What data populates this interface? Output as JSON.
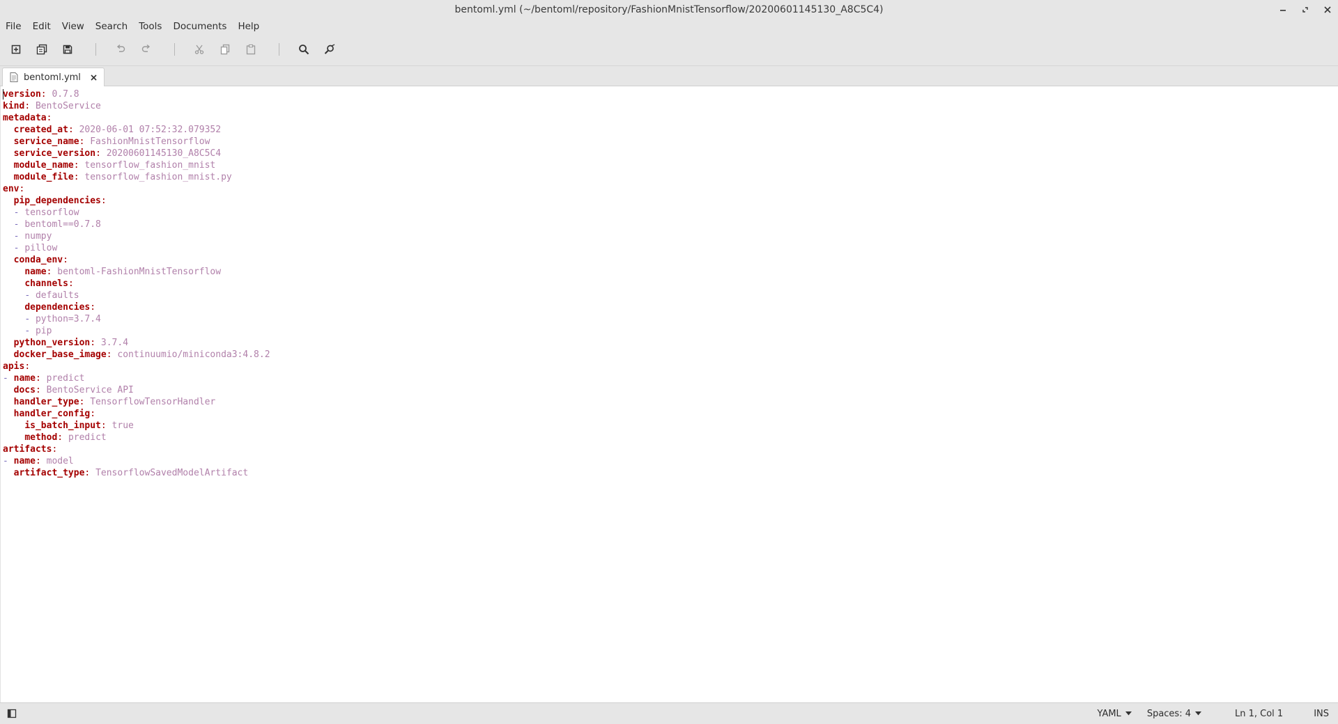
{
  "window": {
    "title": "bentoml.yml (~/bentoml/repository/FashionMnistTensorflow/20200601145130_A8C5C4)"
  },
  "menubar": {
    "items": [
      "File",
      "Edit",
      "View",
      "Search",
      "Tools",
      "Documents",
      "Help"
    ]
  },
  "toolbar": {
    "buttons": [
      {
        "name": "new-document-icon"
      },
      {
        "name": "open-document-icon"
      },
      {
        "name": "save-document-icon"
      },
      {
        "name": "undo-icon"
      },
      {
        "name": "redo-icon"
      },
      {
        "name": "cut-icon"
      },
      {
        "name": "copy-icon"
      },
      {
        "name": "paste-icon"
      },
      {
        "name": "search-icon"
      },
      {
        "name": "replace-icon"
      }
    ]
  },
  "tabs": [
    {
      "label": "bentoml.yml",
      "active": true
    }
  ],
  "editor": {
    "language": "yaml",
    "lines": [
      [
        {
          "t": "k",
          "s": "version"
        },
        {
          "t": "p",
          "s": ": "
        },
        {
          "t": "v",
          "s": "0.7.8"
        }
      ],
      [
        {
          "t": "k",
          "s": "kind"
        },
        {
          "t": "p",
          "s": ": "
        },
        {
          "t": "v",
          "s": "BentoService"
        }
      ],
      [
        {
          "t": "k",
          "s": "metadata"
        },
        {
          "t": "p",
          "s": ":"
        }
      ],
      [
        {
          "t": "x",
          "s": "  "
        },
        {
          "t": "k",
          "s": "created_at"
        },
        {
          "t": "p",
          "s": ": "
        },
        {
          "t": "v",
          "s": "2020-06-01 07:52:32.079352"
        }
      ],
      [
        {
          "t": "x",
          "s": "  "
        },
        {
          "t": "k",
          "s": "service_name"
        },
        {
          "t": "p",
          "s": ": "
        },
        {
          "t": "v",
          "s": "FashionMnistTensorflow"
        }
      ],
      [
        {
          "t": "x",
          "s": "  "
        },
        {
          "t": "k",
          "s": "service_version"
        },
        {
          "t": "p",
          "s": ": "
        },
        {
          "t": "v",
          "s": "20200601145130_A8C5C4"
        }
      ],
      [
        {
          "t": "x",
          "s": "  "
        },
        {
          "t": "k",
          "s": "module_name"
        },
        {
          "t": "p",
          "s": ": "
        },
        {
          "t": "v",
          "s": "tensorflow_fashion_mnist"
        }
      ],
      [
        {
          "t": "x",
          "s": "  "
        },
        {
          "t": "k",
          "s": "module_file"
        },
        {
          "t": "p",
          "s": ": "
        },
        {
          "t": "v",
          "s": "tensorflow_fashion_mnist.py"
        }
      ],
      [
        {
          "t": "k",
          "s": "env"
        },
        {
          "t": "p",
          "s": ":"
        }
      ],
      [
        {
          "t": "x",
          "s": "  "
        },
        {
          "t": "k",
          "s": "pip_dependencies"
        },
        {
          "t": "p",
          "s": ":"
        }
      ],
      [
        {
          "t": "x",
          "s": "  "
        },
        {
          "t": "d",
          "s": "- "
        },
        {
          "t": "v",
          "s": "tensorflow"
        }
      ],
      [
        {
          "t": "x",
          "s": "  "
        },
        {
          "t": "d",
          "s": "- "
        },
        {
          "t": "v",
          "s": "bentoml==0.7.8"
        }
      ],
      [
        {
          "t": "x",
          "s": "  "
        },
        {
          "t": "d",
          "s": "- "
        },
        {
          "t": "v",
          "s": "numpy"
        }
      ],
      [
        {
          "t": "x",
          "s": "  "
        },
        {
          "t": "d",
          "s": "- "
        },
        {
          "t": "v",
          "s": "pillow"
        }
      ],
      [
        {
          "t": "x",
          "s": "  "
        },
        {
          "t": "k",
          "s": "conda_env"
        },
        {
          "t": "p",
          "s": ":"
        }
      ],
      [
        {
          "t": "x",
          "s": "    "
        },
        {
          "t": "k",
          "s": "name"
        },
        {
          "t": "p",
          "s": ": "
        },
        {
          "t": "v",
          "s": "bentoml-FashionMnistTensorflow"
        }
      ],
      [
        {
          "t": "x",
          "s": "    "
        },
        {
          "t": "k",
          "s": "channels"
        },
        {
          "t": "p",
          "s": ":"
        }
      ],
      [
        {
          "t": "x",
          "s": "    "
        },
        {
          "t": "d",
          "s": "- "
        },
        {
          "t": "v",
          "s": "defaults"
        }
      ],
      [
        {
          "t": "x",
          "s": "    "
        },
        {
          "t": "k",
          "s": "dependencies"
        },
        {
          "t": "p",
          "s": ":"
        }
      ],
      [
        {
          "t": "x",
          "s": "    "
        },
        {
          "t": "d",
          "s": "- "
        },
        {
          "t": "v",
          "s": "python=3.7.4"
        }
      ],
      [
        {
          "t": "x",
          "s": "    "
        },
        {
          "t": "d",
          "s": "- "
        },
        {
          "t": "v",
          "s": "pip"
        }
      ],
      [
        {
          "t": "x",
          "s": "  "
        },
        {
          "t": "k",
          "s": "python_version"
        },
        {
          "t": "p",
          "s": ": "
        },
        {
          "t": "v",
          "s": "3.7.4"
        }
      ],
      [
        {
          "t": "x",
          "s": "  "
        },
        {
          "t": "k",
          "s": "docker_base_image"
        },
        {
          "t": "p",
          "s": ": "
        },
        {
          "t": "v",
          "s": "continuumio/miniconda3:4.8.2"
        }
      ],
      [
        {
          "t": "k",
          "s": "apis"
        },
        {
          "t": "p",
          "s": ":"
        }
      ],
      [
        {
          "t": "d",
          "s": "- "
        },
        {
          "t": "k",
          "s": "name"
        },
        {
          "t": "p",
          "s": ": "
        },
        {
          "t": "v",
          "s": "predict"
        }
      ],
      [
        {
          "t": "x",
          "s": "  "
        },
        {
          "t": "k",
          "s": "docs"
        },
        {
          "t": "p",
          "s": ": "
        },
        {
          "t": "v",
          "s": "BentoService API"
        }
      ],
      [
        {
          "t": "x",
          "s": "  "
        },
        {
          "t": "k",
          "s": "handler_type"
        },
        {
          "t": "p",
          "s": ": "
        },
        {
          "t": "v",
          "s": "TensorflowTensorHandler"
        }
      ],
      [
        {
          "t": "x",
          "s": "  "
        },
        {
          "t": "k",
          "s": "handler_config"
        },
        {
          "t": "p",
          "s": ":"
        }
      ],
      [
        {
          "t": "x",
          "s": "    "
        },
        {
          "t": "k",
          "s": "is_batch_input"
        },
        {
          "t": "p",
          "s": ": "
        },
        {
          "t": "v",
          "s": "true"
        }
      ],
      [
        {
          "t": "x",
          "s": "    "
        },
        {
          "t": "k",
          "s": "method"
        },
        {
          "t": "p",
          "s": ": "
        },
        {
          "t": "v",
          "s": "predict"
        }
      ],
      [
        {
          "t": "k",
          "s": "artifacts"
        },
        {
          "t": "p",
          "s": ":"
        }
      ],
      [
        {
          "t": "d",
          "s": "- "
        },
        {
          "t": "k",
          "s": "name"
        },
        {
          "t": "p",
          "s": ": "
        },
        {
          "t": "v",
          "s": "model"
        }
      ],
      [
        {
          "t": "x",
          "s": "  "
        },
        {
          "t": "k",
          "s": "artifact_type"
        },
        {
          "t": "p",
          "s": ": "
        },
        {
          "t": "v",
          "s": "TensorflowSavedModelArtifact"
        }
      ]
    ]
  },
  "statusbar": {
    "language": "YAML",
    "indent": "Spaces: 4",
    "position": "Ln 1, Col 1",
    "mode": "INS"
  },
  "colors": {
    "key": "#a40000",
    "value": "#b180aa",
    "dash": "#7a6dbb",
    "chrome": "#e6e6e6"
  }
}
